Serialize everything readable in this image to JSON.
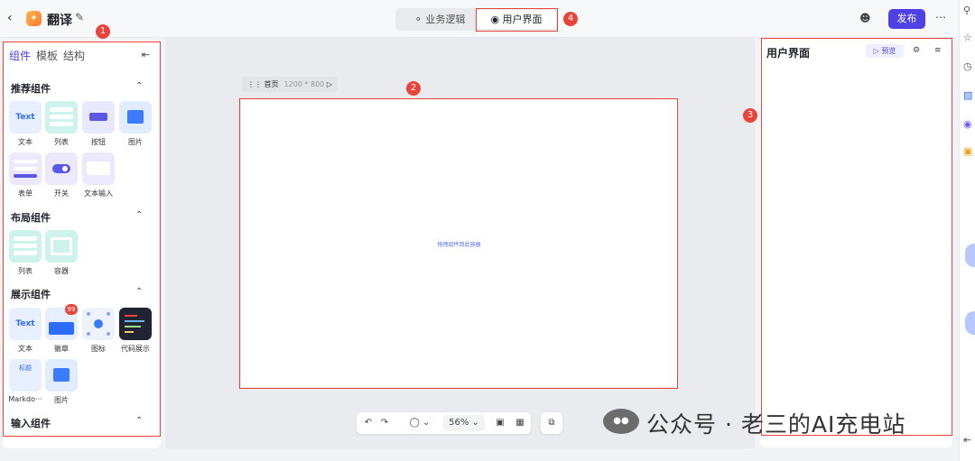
{
  "header": {
    "app_name": "翻译",
    "tabs": [
      {
        "label": "业务逻辑"
      },
      {
        "label": "用户界面"
      }
    ],
    "publish_label": "发布",
    "back_icon": "chevron-left-icon",
    "more_icon": "more-icon"
  },
  "annotations": [
    "1",
    "2",
    "3",
    "4"
  ],
  "left_panel": {
    "tabs": [
      "组件",
      "模板",
      "结构"
    ],
    "sections": [
      {
        "title": "推荐组件",
        "items": [
          {
            "label": "文本",
            "tile_text": "Text"
          },
          {
            "label": "列表"
          },
          {
            "label": "按钮"
          },
          {
            "label": "图片"
          },
          {
            "label": "表单"
          },
          {
            "label": "开关"
          },
          {
            "label": "文本输入"
          }
        ]
      },
      {
        "title": "布局组件",
        "items": [
          {
            "label": "列表"
          },
          {
            "label": "容器"
          }
        ]
      },
      {
        "title": "展示组件",
        "items": [
          {
            "label": "文本",
            "tile_text": "Text"
          },
          {
            "label": "徽章",
            "badge": "99"
          },
          {
            "label": "图标"
          },
          {
            "label": "代码展示"
          },
          {
            "label": "Markdo···",
            "tile_text": "标题"
          },
          {
            "label": "图片"
          }
        ]
      },
      {
        "title": "输入组件",
        "items": []
      }
    ]
  },
  "canvas": {
    "page_name": "首页",
    "page_size": "1200 * 800",
    "placeholder": "拖拽组件到此容器"
  },
  "toolbar": {
    "zoom": "56%"
  },
  "right_panel": {
    "title": "用户界面",
    "preview_label": "预览"
  },
  "watermark": "公众号 · 老三的AI充电站",
  "colors": {
    "accent": "#4e40e5",
    "annotation": "#e8443a"
  }
}
